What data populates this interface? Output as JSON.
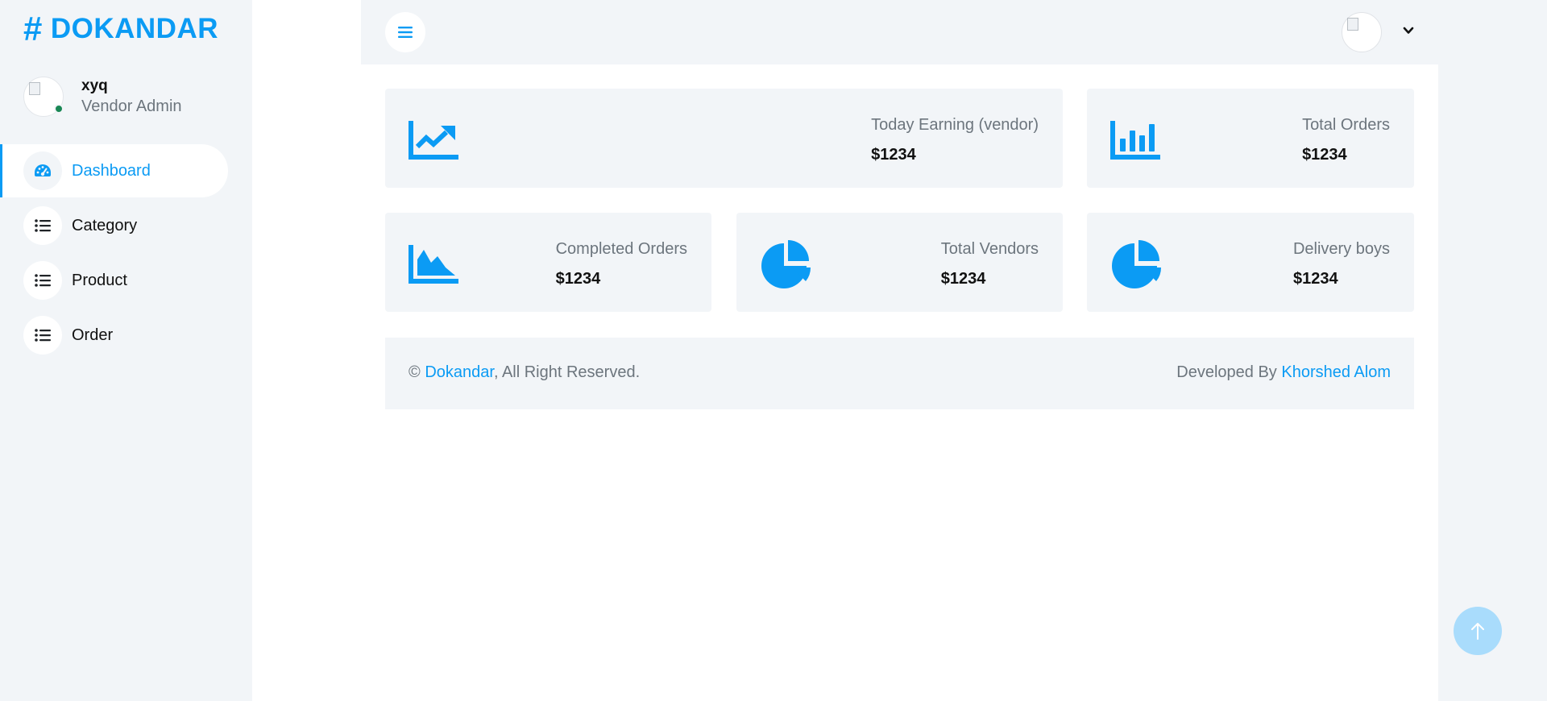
{
  "brand": {
    "hash": "#",
    "name": "DOKANDAR"
  },
  "profile": {
    "name": "xyq",
    "role": "Vendor Admin"
  },
  "nav": [
    {
      "label": "Dashboard",
      "icon": "gauge-icon",
      "active": true
    },
    {
      "label": "Category",
      "icon": "list-icon"
    },
    {
      "label": "Product",
      "icon": "list-icon"
    },
    {
      "label": "Order",
      "icon": "list-icon"
    }
  ],
  "topbar": {
    "menu_icon": "hamburger-icon",
    "caret_icon": "chevron-down-icon"
  },
  "cards": [
    {
      "title": "Today Earning (vendor)",
      "value": "$1234",
      "icon": "chart-line-icon"
    },
    {
      "title": "Total Orders",
      "value": "$1234",
      "icon": "chart-bar-icon"
    },
    {
      "title": "Completed Orders",
      "value": "$1234",
      "icon": "chart-area-icon"
    },
    {
      "title": "Total Vendors",
      "value": "$1234",
      "icon": "chart-pie-icon"
    },
    {
      "title": "Delivery boys",
      "value": "$1234",
      "icon": "chart-pie-icon"
    }
  ],
  "footer": {
    "copyright_symbol": "©",
    "brand_link": "Dokandar",
    "rights": ", All Right Reserved.",
    "developed_by": "Developed By",
    "developer_link": "Khorshed Alom"
  },
  "colors": {
    "accent": "#0b9bf4",
    "panel": "#f2f5f8",
    "online": "#198754"
  }
}
